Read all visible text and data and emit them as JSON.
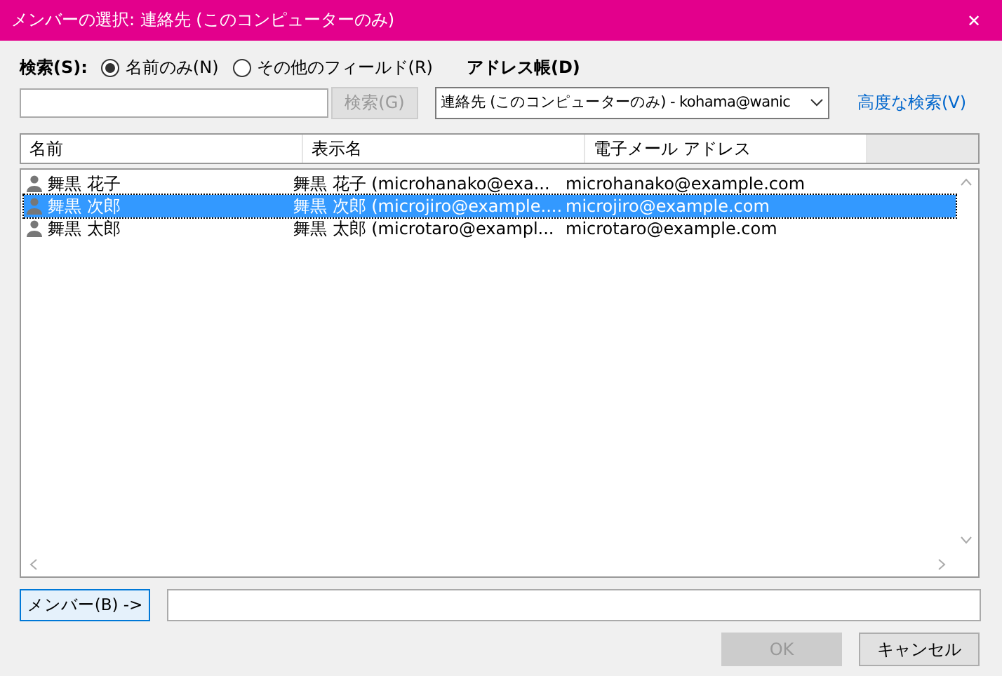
{
  "window": {
    "title": "メンバーの選択: 連絡先 (このコンピューターのみ)",
    "close": "✕"
  },
  "search": {
    "label": "検索(S):",
    "options": [
      {
        "label": "名前のみ(N)",
        "selected": true
      },
      {
        "label": "その他のフィールド(R)",
        "selected": false
      }
    ],
    "button": {
      "label": "検索(G)",
      "disabled": true
    }
  },
  "address_book": {
    "label": "アドレス帳(D)",
    "value": "連絡先 (このコンピューターのみ) - kohama@wanic"
  },
  "advanced_search": "高度な検索(V)",
  "table": {
    "columns": [
      "名前",
      "表示名",
      "電子メール アドレス"
    ],
    "rows": [
      {
        "name": "舞黒 花子",
        "display_name": "舞黒 花子 (microhanako@exa...",
        "email": "microhanako@example.com",
        "selected": false
      },
      {
        "name": "舞黒 次郎",
        "display_name": "舞黒 次郎 (microjiro@example....",
        "email": "microjiro@example.com",
        "selected": true
      },
      {
        "name": "舞黒 太郎",
        "display_name": "舞黒 太郎 (microtaro@exampl...",
        "email": "microtaro@example.com",
        "selected": false
      }
    ]
  },
  "members_button": "メンバー(B) ->",
  "buttons": [
    {
      "label": "OK",
      "disabled": true
    },
    {
      "label": "キャンセル",
      "disabled": false
    }
  ]
}
